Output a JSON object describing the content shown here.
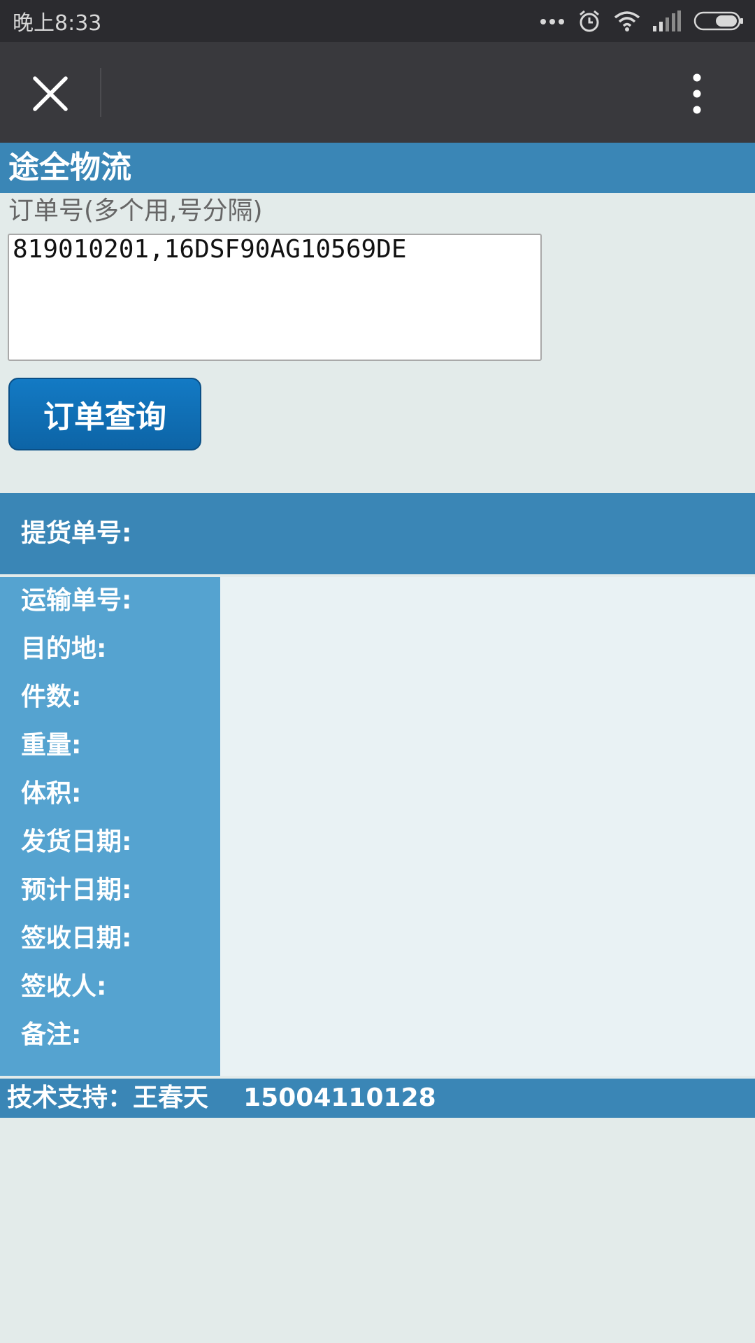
{
  "status_bar": {
    "time": "晚上8:33",
    "icons": [
      "more-dots-icon",
      "alarm-icon",
      "wifi-icon",
      "signal-icon",
      "battery-icon"
    ]
  },
  "title_bar": {
    "close_icon": "close-icon",
    "more_icon": "more-vertical-icon"
  },
  "header": {
    "title": "途全物流"
  },
  "query": {
    "order_label": "订单号(多个用,号分隔)",
    "order_value": "819010201,16DSF90AG10569DE",
    "button_label": "订单查询"
  },
  "result": {
    "pickup_label": "提货单号:",
    "fields": [
      "运输单号:",
      "目的地:",
      "件数:",
      "重量:",
      "体积:",
      "发货日期:",
      "预计日期:",
      "签收日期:",
      "签收人:",
      "备注:"
    ]
  },
  "footer": {
    "text": "技术支持：王春天    15004110128"
  },
  "colors": {
    "header_blue": "#3a86b6",
    "label_column_blue": "#55a3d0",
    "button_blue": "#0d64a6",
    "background": "#e3ebea"
  }
}
